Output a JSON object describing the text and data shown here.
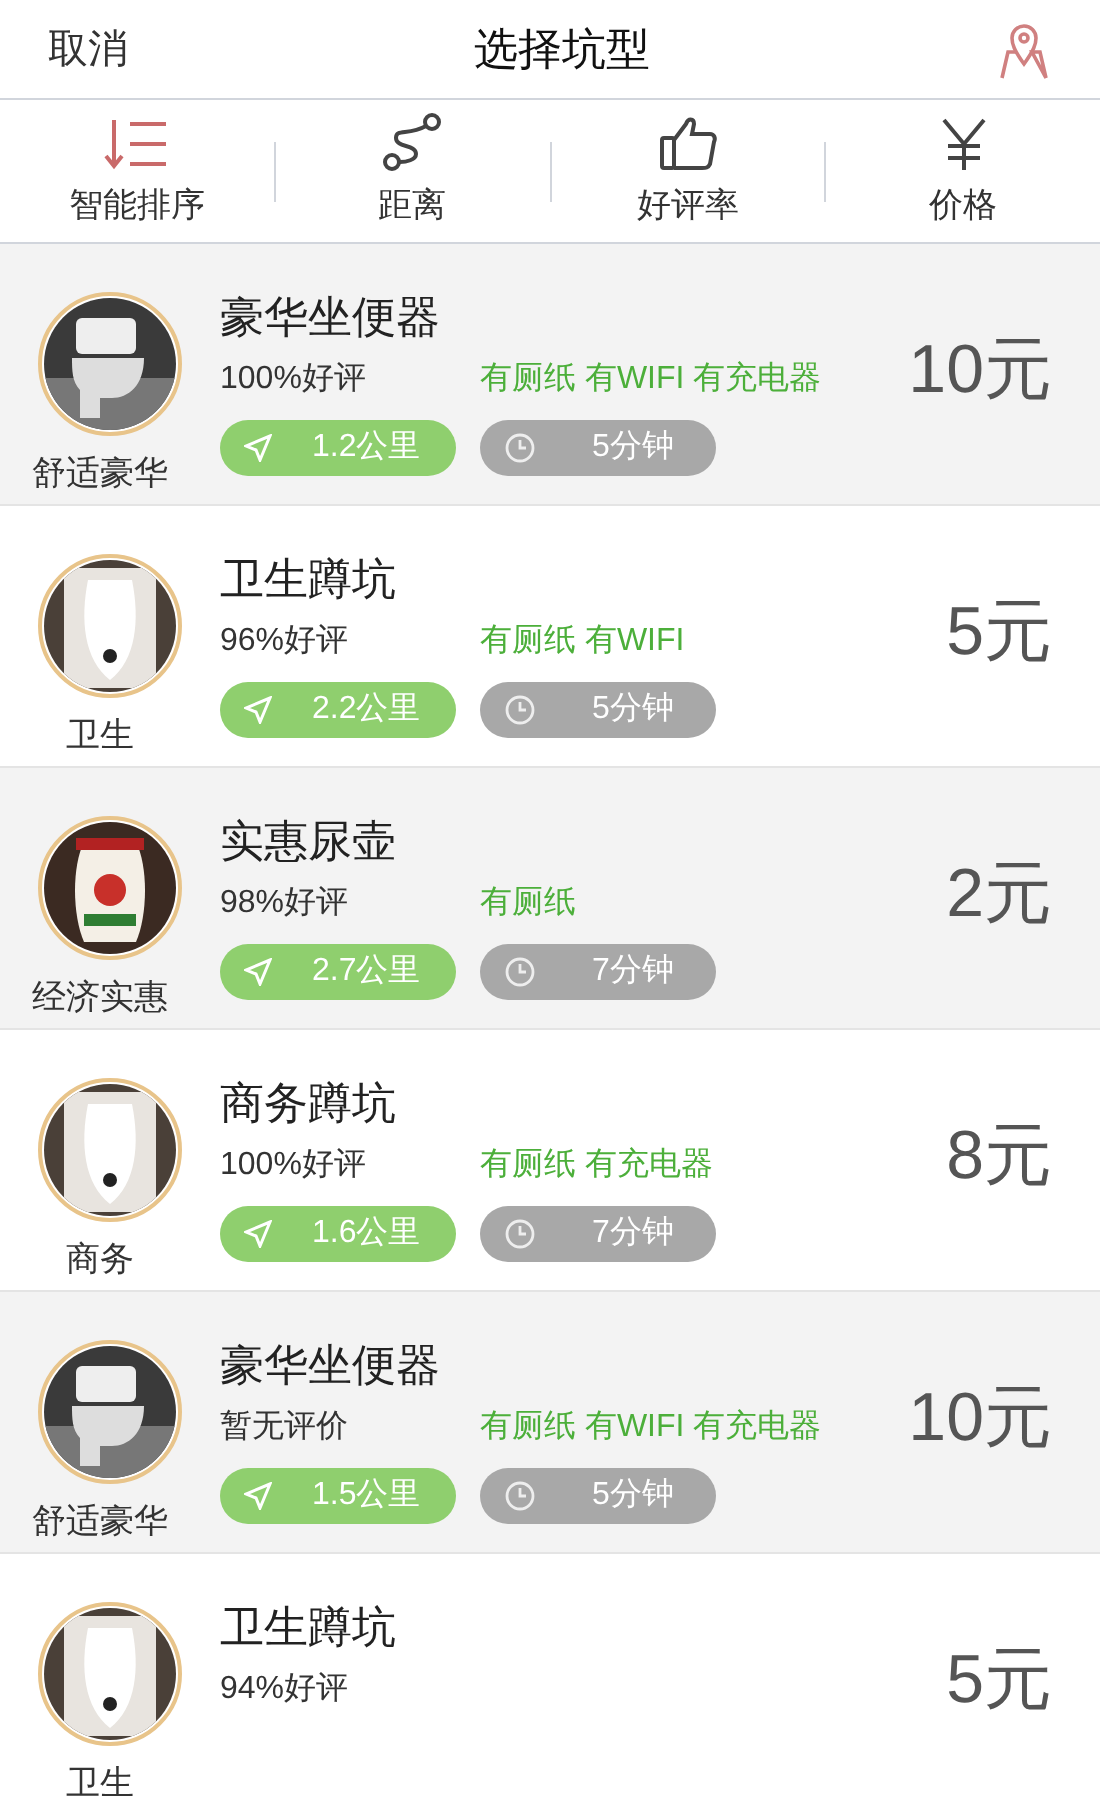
{
  "header": {
    "cancel": "取消",
    "title": "选择坑型"
  },
  "sort_tabs": [
    {
      "label": "智能排序",
      "kind": "sort",
      "selected": true
    },
    {
      "label": "距离",
      "kind": "route",
      "selected": false
    },
    {
      "label": "好评率",
      "kind": "thumb",
      "selected": false
    },
    {
      "label": "价格",
      "kind": "yen",
      "selected": false
    }
  ],
  "stalls": [
    {
      "kind": "seat",
      "label": "舒适豪华",
      "name": "豪华坐便器",
      "rating": "100%好评",
      "features": "有厕纸 有WIFI 有充电器",
      "price": "10元",
      "distance": "1.2公里",
      "wait": "5分钟"
    },
    {
      "kind": "squat",
      "label": "卫生",
      "name": "卫生蹲坑",
      "rating": "96%好评",
      "features": "有厕纸 有WIFI",
      "price": "5元",
      "distance": "2.2公里",
      "wait": "5分钟"
    },
    {
      "kind": "vase",
      "label": "经济实惠",
      "name": "实惠尿壶",
      "rating": "98%好评",
      "features": "有厕纸",
      "price": "2元",
      "distance": "2.7公里",
      "wait": "7分钟"
    },
    {
      "kind": "squat",
      "label": "商务",
      "name": "商务蹲坑",
      "rating": "100%好评",
      "features": "有厕纸 有充电器",
      "price": "8元",
      "distance": "1.6公里",
      "wait": "7分钟"
    },
    {
      "kind": "seat",
      "label": "舒适豪华",
      "name": "豪华坐便器",
      "rating": "暂无评价",
      "features": "有厕纸 有WIFI 有充电器",
      "price": "10元",
      "distance": "1.5公里",
      "wait": "5分钟"
    },
    {
      "kind": "squat",
      "label": "卫生",
      "name": "卫生蹲坑",
      "rating": "94%好评",
      "price": "5元"
    }
  ]
}
